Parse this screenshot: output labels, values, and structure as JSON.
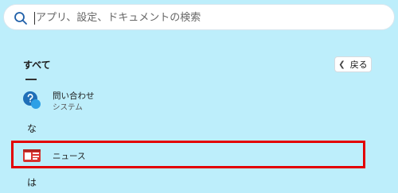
{
  "search": {
    "placeholder": "アプリ、設定、ドキュメントの検索"
  },
  "list": {
    "section_title": "すべて",
    "back_label": "戻る",
    "items": [
      {
        "name": "問い合わせ",
        "subtitle": "システム",
        "icon": "get-help-icon"
      },
      {
        "name": "ニュース",
        "icon": "news-icon"
      }
    ],
    "headers": [
      "な",
      "は"
    ]
  },
  "colors": {
    "background": "#bdeefb",
    "highlight": "#e30000",
    "news_icon": "#d9322e",
    "help_icon": "#1f6fb8"
  }
}
